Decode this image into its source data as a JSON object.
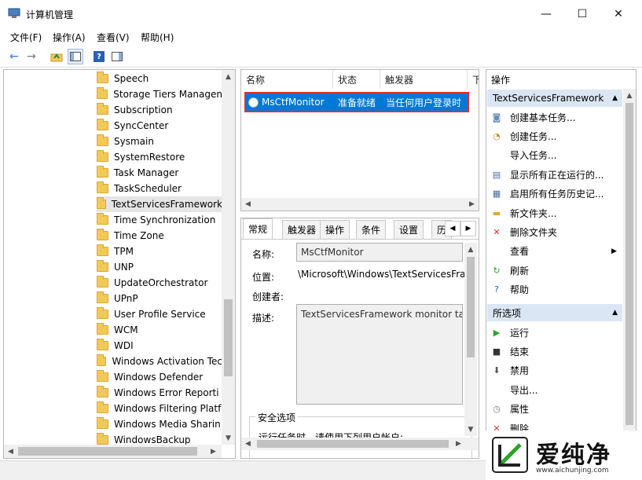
{
  "window": {
    "title": "计算机管理",
    "minimize": "—",
    "maximize": "☐",
    "close": "✕"
  },
  "menu": [
    "文件(F)",
    "操作(A)",
    "查看(V)",
    "帮助(H)"
  ],
  "toolbar": {
    "back": "←",
    "forward": "→",
    "help": "?"
  },
  "tree": {
    "items": [
      "Speech",
      "Storage Tiers Managen",
      "Subscription",
      "SyncCenter",
      "Sysmain",
      "SystemRestore",
      "Task Manager",
      "TaskScheduler",
      "TextServicesFramework",
      "Time Synchronization",
      "Time Zone",
      "TPM",
      "UNP",
      "UpdateOrchestrator",
      "UPnP",
      "User Profile Service",
      "WCM",
      "WDI",
      "Windows Activation Tec",
      "Windows Defender",
      "Windows Error Reporti",
      "Windows Filtering Platf",
      "Windows Media Sharin",
      "WindowsBackup"
    ],
    "selected_index": 8
  },
  "task_list": {
    "columns": [
      "名称",
      "状态",
      "触发器",
      "下"
    ],
    "row": {
      "name": "MsCtfMonitor",
      "status": "准备就绪",
      "trigger": "当任何用户登录时"
    }
  },
  "details": {
    "tabs": [
      "常规",
      "触发器",
      "操作",
      "条件",
      "设置",
      "历"
    ],
    "active_tab_index": 0,
    "fields": {
      "name_label": "名称:",
      "name_value": "MsCtfMonitor",
      "location_label": "位置:",
      "location_value": "\\Microsoft\\Windows\\TextServicesFra",
      "author_label": "创建者:",
      "description_label": "描述:",
      "description_value": "TextServicesFramework monitor tas",
      "security_label": "安全选项",
      "security_text": "运行任务时，请使用下列用户帐户:"
    }
  },
  "actions": {
    "header": "操作",
    "section1_title": "TextServicesFramework",
    "section1_items": [
      {
        "label": "创建基本任务...",
        "icon": "wizard-icon"
      },
      {
        "label": "创建任务...",
        "icon": "new-task-icon"
      },
      {
        "label": "导入任务...",
        "icon": ""
      },
      {
        "label": "显示所有正在运行的...",
        "icon": "running-tasks-icon"
      },
      {
        "label": "启用所有任务历史记...",
        "icon": "history-icon"
      },
      {
        "label": "新文件夹...",
        "icon": "folder-icon"
      },
      {
        "label": "删除文件夹",
        "icon": "delete-icon"
      },
      {
        "label": "查看",
        "icon": ""
      },
      {
        "label": "刷新",
        "icon": "refresh-icon"
      },
      {
        "label": "帮助",
        "icon": "help-icon"
      }
    ],
    "section2_title": "所选项",
    "section2_items": [
      {
        "label": "运行",
        "icon": "run-icon"
      },
      {
        "label": "结束",
        "icon": "stop-icon"
      },
      {
        "label": "禁用",
        "icon": "disable-icon"
      },
      {
        "label": "导出...",
        "icon": ""
      },
      {
        "label": "属性",
        "icon": "properties-icon"
      },
      {
        "label": "删除",
        "icon": "delete-icon"
      }
    ]
  },
  "watermark": {
    "brand": "爱纯净",
    "url": "www.aichunjing.com"
  },
  "colors": {
    "selection": "#0078d7",
    "highlight_border": "#d9352b",
    "section_bg": "#dbe6f4",
    "accent_green": "#2aa52a"
  }
}
